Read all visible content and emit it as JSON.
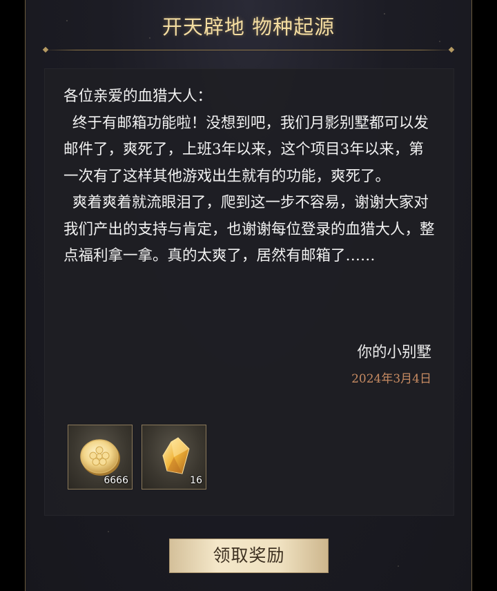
{
  "mail": {
    "title": "开天辟地 物种起源",
    "greeting": "各位亲爱的血猎大人：",
    "paragraph1": "终于有邮箱功能啦！没想到吧，我们月影别墅都可以发邮件了，爽死了，上班3年以来，这个项目3年以来，第一次有了这样其他游戏出生就有的功能，爽死了。",
    "paragraph2": "爽着爽着就流眼泪了，爬到这一步不容易，谢谢大家对我们产出的支持与肯定，也谢谢每位登录的血猎大人，整点福利拿一拿。真的太爽了，居然有邮箱了……",
    "signature": "你的小别墅",
    "date": "2024年3月4日"
  },
  "rewards": [
    {
      "icon": "gold-coin-icon",
      "quantity": "6666"
    },
    {
      "icon": "gold-crystal-icon",
      "quantity": "16"
    }
  ],
  "claim_button": {
    "label": "领取奖励"
  },
  "colors": {
    "title": "#f3dca0",
    "date": "#c78b62",
    "button_bg": "#f1e3c3"
  }
}
